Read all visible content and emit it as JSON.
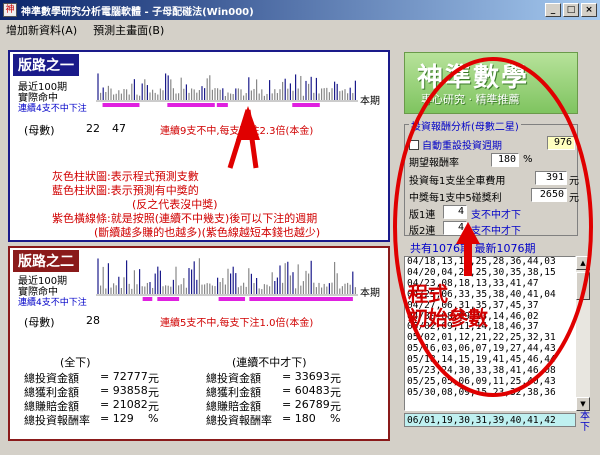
{
  "window": {
    "title": "神準數學研究分析電腦軟體 - 子母配碰法(Win000)",
    "buttons": [
      "_",
      "□",
      "×"
    ]
  },
  "menu": [
    "增加新資料(A)",
    "預測主畫面(B)"
  ],
  "panel1": {
    "title": "版路之一",
    "recent_label": "最近100期",
    "actual_label": "實際命中",
    "streak_label": "連續4支不中下注",
    "period_label": "本期",
    "count_label": "(母數)",
    "count_a": "22",
    "count_b": "47",
    "info": "連續9支不中,每支下注2.3倍(本金)",
    "legend": [
      "灰色柱狀圖:表示程式預測支數",
      "藍色柱狀圖:表示預測有中獎的",
      "(反之代表沒中獎)",
      "紫色橫線條:就是按照(連續不中幾支)後可以下注的週期",
      "(斷續越多賺的也越多)(紫色線越短本錢也越少)"
    ]
  },
  "panel2": {
    "title": "版路之二",
    "recent_label": "最近100期",
    "actual_label": "實際命中",
    "streak_label": "連續4支不中下注",
    "period_label": "本期",
    "count_label": "(母數)",
    "count_a": "28",
    "info": "連續5支不中,每支下注1.0倍(本金)",
    "col_all": "(全下)",
    "col_streak": "(連續不中才下)",
    "stats_left": [
      {
        "label": "總投資金額",
        "value": "= 72777",
        "unit": "元"
      },
      {
        "label": "總獲利金額",
        "value": "= 93858",
        "unit": "元"
      },
      {
        "label": "總賺賠金額",
        "value": "= 21082",
        "unit": "元"
      },
      {
        "label": "總投資報酬率",
        "value": "= 129",
        "unit": "%"
      }
    ],
    "stats_right": [
      {
        "label": "總投資金額",
        "value": "= 33693",
        "unit": "元"
      },
      {
        "label": "總獲利金額",
        "value": "= 60483",
        "unit": "元"
      },
      {
        "label": "總賺賠金額",
        "value": "= 26789",
        "unit": "元"
      },
      {
        "label": "總投資報酬率",
        "value": "= 180",
        "unit": "%"
      }
    ]
  },
  "logo": {
    "big": "神準數學",
    "sub": "專心研究 · 精準推薦"
  },
  "settings": {
    "group_title": "投資報酬分析(母數二星)",
    "auto_reset": "自動重設投資週期",
    "auto_reset_value": "976",
    "expected_label": "期望報酬率",
    "expected_value": "180",
    "expected_unit": "%",
    "cost_label": "投資每1支坐全車費用",
    "cost_value": "391",
    "cost_unit": "元",
    "prize_label": "中獎每1支中5碰獎利",
    "prize_value": "2650",
    "prize_unit": "元",
    "path1_label": "版1連",
    "path1_value": "4",
    "path1_suffix": "支不中才下",
    "path2_label": "版2連",
    "path2_value": "4",
    "path2_suffix": "支不中才下"
  },
  "period_text": "共有1076期  最新1076期",
  "draws": [
    "04/18,13,18,25,28,36,44,03",
    "04/20,04,20,25,30,35,38,15",
    "04/23,08,18,13,33,41,47",
    "04/25,06,33,35,38,40,41,04",
    "04/27,06,31,35,37,45,37",
    "04/30,08,09,13,14,46,02",
    "05/02,09,11,14,18,46,37",
    "05/02,01,12,21,22,25,32,31",
    "05/16,03,06,07,19,27,44,43",
    "05/18,14,15,19,41,45,46,44",
    "05/23,24,30,33,38,41,46,08",
    "05/25,05,06,09,11,25,40,43",
    "05/30,08,09,15,23,32,38,36",
    "06/01,19,30,31,39,40,41,42"
  ],
  "next_label": "本下",
  "annotation": {
    "line1": "程式",
    "line2": "初始參數"
  },
  "colors": {
    "accent_red": "#d00000",
    "bar_blue": "#1a1a8a",
    "bar_purple": "#e020e0",
    "bar_gray": "#888888"
  }
}
